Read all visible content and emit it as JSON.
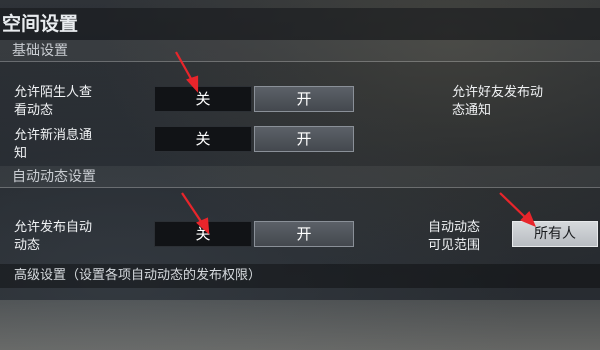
{
  "title": "空间设置",
  "sections": {
    "basic": "基础设置",
    "auto": "自动动态设置"
  },
  "settings": {
    "stranger_view": {
      "label": "允许陌生人查\n看动态",
      "off": "关",
      "on": "开"
    },
    "friend_post_notify": {
      "label": "允许好友发布动\n态通知"
    },
    "new_message_notify": {
      "label": "允许新消息通\n知",
      "off": "关",
      "on": "开"
    },
    "auto_post": {
      "label": "允许发布自动\n动态",
      "off": "关",
      "on": "开"
    },
    "auto_visibility": {
      "label": "自动动态\n可见范围",
      "value": "所有人"
    }
  },
  "advanced": "高级设置（设置各项自动动态的发布权限）",
  "colors": {
    "annotation_arrow": "#e8252b"
  }
}
